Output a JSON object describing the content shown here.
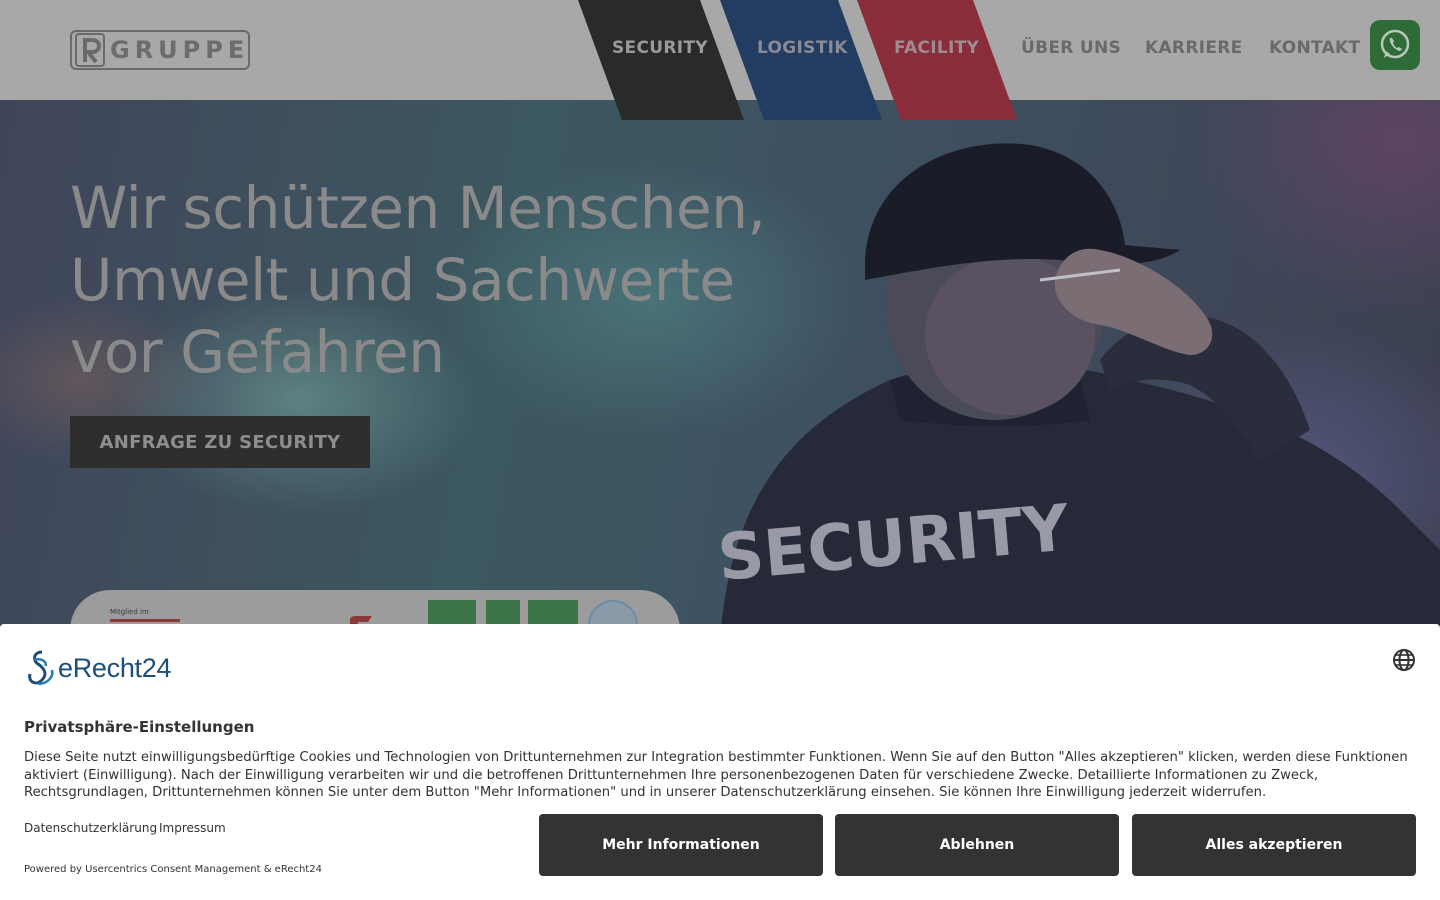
{
  "header": {
    "logo_text": "GRUPPE",
    "logo_letter": "R",
    "nav": {
      "security": "SECURITY",
      "logistik": "LOGISTIK",
      "facility": "FACILITY",
      "ueber_uns": "ÜBER UNS",
      "karriere": "KARRIERE",
      "kontakt": "KONTAKT"
    },
    "whatsapp_icon": "whatsapp-icon",
    "stripe_colors": {
      "security": "#2a2a2a",
      "logistik": "#233c62",
      "facility": "#8a2c3a"
    }
  },
  "hero": {
    "title": "Wir schützen Menschen, Umwelt und Sachwerte vor Gefahren",
    "cta_label": "ANFRAGE ZU SECURITY",
    "jacket_text": "SECURITY",
    "cert_member_label": "Mitglied im"
  },
  "cookie": {
    "brand": "eRecht24",
    "title": "Privatsphäre-Einstellungen",
    "text": "Diese Seite nutzt einwilligungsbedürftige Cookies und Technologien von Drittunternehmen zur Integration bestimmter Funktionen. Wenn Sie auf den Button \"Alles akzeptieren\" klicken, werden diese Funktionen aktiviert (Einwilligung). Nach der Einwilligung verarbeiten wir und die betroffenen Drittunternehmen Ihre personenbezogenen Daten für verschiedene Zwecke. Detaillierte Informationen zu Zweck, Rechtsgrundlagen, Drittunternehmen können Sie unter dem Button \"Mehr Informationen\" und in unserer Datenschutzerklärung einsehen. Sie können Ihre Einwilligung jederzeit widerrufen.",
    "link_privacy": "Datenschutzerklärung",
    "link_imprint": "Impressum",
    "powered_by": "Powered by Usercentrics Consent Management & eRecht24",
    "btn_more": "Mehr Informationen",
    "btn_deny": "Ablehnen",
    "btn_accept": "Alles akzeptieren",
    "globe_icon": "globe-icon"
  }
}
